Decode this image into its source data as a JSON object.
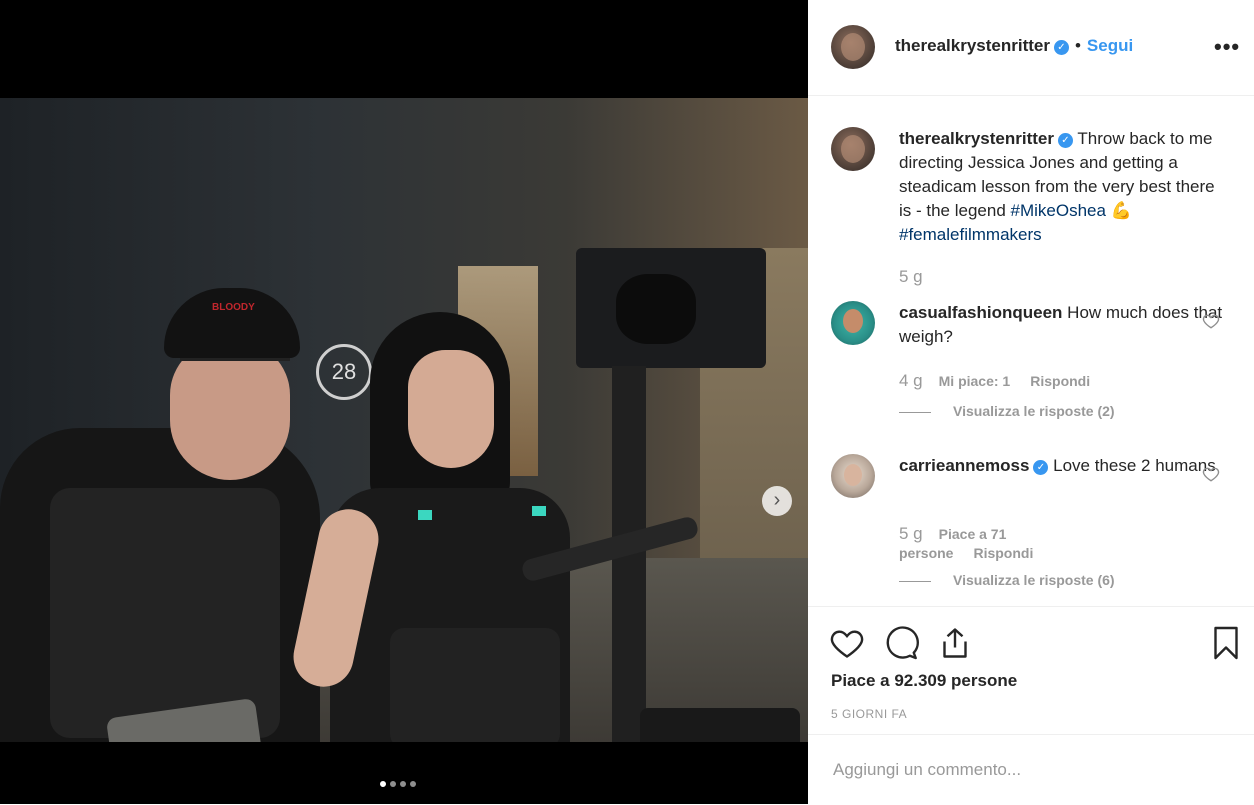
{
  "post": {
    "username": "therealkrystenritter",
    "follow_label": "Segui",
    "separator": "•",
    "more_label": "•••",
    "photo_sign": "28",
    "cap_text": "BLOODY",
    "carousel": {
      "count": 4,
      "active": 1
    }
  },
  "caption": {
    "username": "therealkrystenritter",
    "text": "Throw back to me directing Jessica Jones and getting a steadicam lesson from the very best there is - the legend ",
    "tag1": "#MikeOshea",
    "emoji": "💪",
    "tag2": "#femalefilmmakers",
    "age": "5 g"
  },
  "comments": [
    {
      "username": "casualfashionqueen",
      "text": "How much does that weigh?",
      "age": "4 g",
      "likes_label": "Mi piace: 1",
      "reply_label": "Rispondi",
      "view_replies": "Visualizza le risposte (2)"
    },
    {
      "username": "carrieannemoss",
      "verified": true,
      "text": "Love these 2 humans",
      "age": "5 g",
      "likes_label": "Piace a 71 persone",
      "reply_label": "Rispondi",
      "view_replies": "Visualizza le risposte (6)"
    }
  ],
  "actions": {
    "likes_text": "Piace a 92.309 persone",
    "date": "5 GIORNI FA",
    "comment_placeholder": "Aggiungi un commento..."
  },
  "icons": {
    "like": "heart-icon",
    "comment": "comment-icon",
    "share": "share-icon",
    "save": "bookmark-icon",
    "next": "chevron-right-icon",
    "verified": "verified-badge-icon"
  },
  "colors": {
    "accent": "#3897f0",
    "hashtag": "#003569",
    "muted": "#999999",
    "text": "#262626"
  }
}
